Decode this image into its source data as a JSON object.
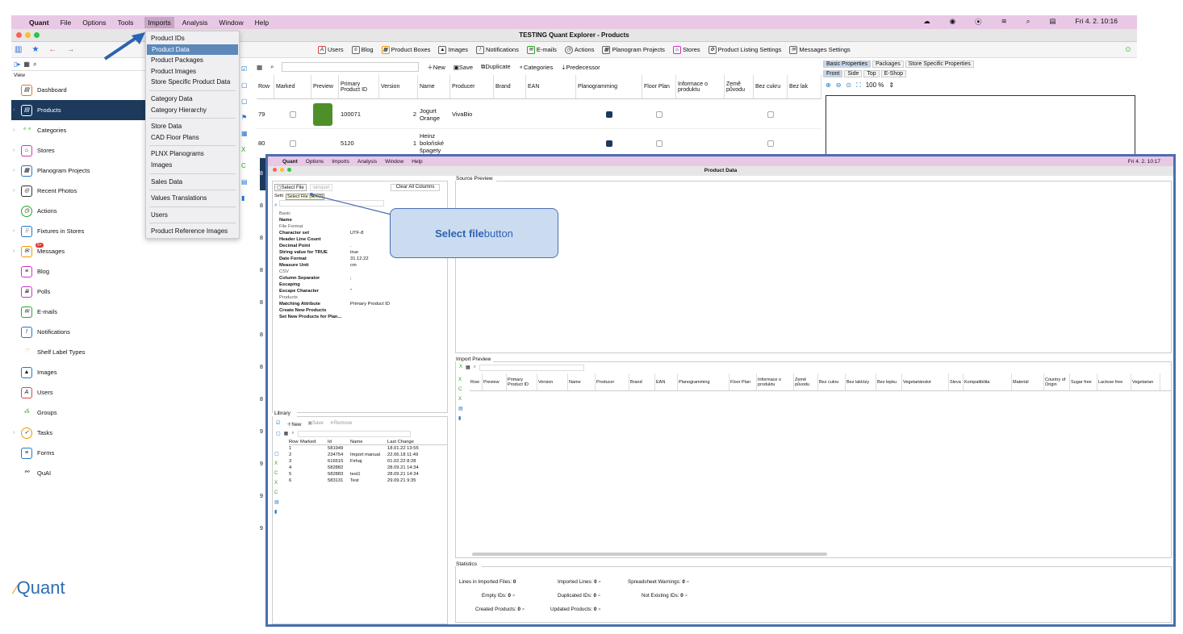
{
  "menubar": {
    "app": "Quant",
    "items": [
      "File",
      "Options",
      "Tools",
      "Imports",
      "Analysis",
      "Window",
      "Help"
    ],
    "clock": "Fri 4. 2.  10:16"
  },
  "window": {
    "title": "TESTING Quant Explorer - Products"
  },
  "toolbar": {
    "items": [
      "Users",
      "Blog",
      "Product Boxes",
      "Images",
      "Notifications",
      "E-mails",
      "Actions",
      "Planogram Projects",
      "Stores",
      "Product Listing Settings",
      "Messages Settings"
    ]
  },
  "sidebar": {
    "view_label": "View",
    "items": [
      "Dashboard",
      "Products",
      "Categories",
      "Stores",
      "Planogram Projects",
      "Recent Photos",
      "Actions",
      "Fixtures in Stores",
      "Messages",
      "Blog",
      "Polls",
      "E-mails",
      "Notifications",
      "Shelf Label Types",
      "Images",
      "Users",
      "Groups",
      "Tasks",
      "Forms",
      "QuAI"
    ],
    "messages_badge": "9+"
  },
  "logo": "Quant",
  "imports_menu": {
    "items": [
      "Product IDs",
      "Product Data",
      "Product Packages",
      "Product Images",
      "Store Specific Product Data",
      "Category Data",
      "Category Hierarchy",
      "Store Data",
      "CAD Floor Plans",
      "PLNX Planograms",
      "Images",
      "Sales Data",
      "Values Translations",
      "Users",
      "Product Reference Images"
    ]
  },
  "products": {
    "toolbar": [
      "New",
      "Save",
      "Duplicate",
      "Categories",
      "Predecessor"
    ],
    "columns": [
      "Row",
      "Marked",
      "Preview",
      "Primary Product ID",
      "Version",
      "Name",
      "Producer",
      "Brand",
      "EAN",
      "Planogramming",
      "Floor Plan",
      "Informace o produktu",
      "Země původu",
      "Bez cukru",
      "Bez lak"
    ],
    "rows": [
      {
        "row": "79",
        "id": "100071",
        "version": "2",
        "name": "Jogurt Orange",
        "producer": "VivaBio"
      },
      {
        "row": "80",
        "id": "5120",
        "version": "1",
        "name": "Heinz boloňské špagety",
        "producer": ""
      }
    ],
    "more_rows": [
      "8",
      "8",
      "8",
      "8",
      "8",
      "8",
      "8",
      "8",
      "9",
      "9",
      "9",
      "9"
    ]
  },
  "right_panel": {
    "tabs": [
      "Basic Properties",
      "Packages",
      "Store Specific Properties"
    ],
    "views": [
      "Front",
      "Side",
      "Top",
      "E-Shop"
    ],
    "zoom": "100 %"
  },
  "overlay": {
    "menubar": {
      "app": "Quant",
      "items": [
        "Options",
        "Imports",
        "Analysis",
        "Window",
        "Help"
      ],
      "clock": "Fri 4. 2.  10:17"
    },
    "title": "Product Data",
    "select_file": "Select File",
    "import": "Import",
    "clear_all": "Clear All Columns",
    "tooltip": "Select File (⌘KO)",
    "settings_label": "Setti",
    "settings": [
      {
        "k": "Basic",
        "v": "",
        "h": true
      },
      {
        "k": "Name",
        "v": ""
      },
      {
        "k": "File Format",
        "v": "",
        "h": true
      },
      {
        "k": "Character set",
        "v": "UTF-8"
      },
      {
        "k": "Header Line Count",
        "v": ""
      },
      {
        "k": "Decimal Point",
        "v": "."
      },
      {
        "k": "String value for TRUE",
        "v": "true"
      },
      {
        "k": "Date Format",
        "v": "31.12.22"
      },
      {
        "k": "Measure Unit",
        "v": "cm"
      },
      {
        "k": "CSV",
        "v": "",
        "h": true
      },
      {
        "k": "Column Separator",
        "v": ";"
      },
      {
        "k": "Escaping",
        "v": ""
      },
      {
        "k": "Escape Character",
        "v": "\""
      },
      {
        "k": "Products",
        "v": "",
        "h": true
      },
      {
        "k": "Matching Attribute",
        "v": "Primary Product ID"
      },
      {
        "k": "Create New Products",
        "v": ""
      },
      {
        "k": "Set New Products for Plan...",
        "v": ""
      }
    ],
    "library": {
      "title": "Library",
      "toolbar": [
        "New",
        "Save",
        "Remove"
      ],
      "columns": [
        "Row",
        "Marked",
        "Id",
        "Name",
        "Last Change"
      ],
      "rows": [
        [
          "1",
          "",
          "581949",
          "",
          "18.01.22 13:55"
        ],
        [
          "2",
          "",
          "234754",
          "Import manual",
          "22.06.18 11:49"
        ],
        [
          "3",
          "",
          "616515",
          "Firhaj",
          "01.02.22 8:28"
        ],
        [
          "4",
          "",
          "582882",
          "",
          "28.09.21 14:34"
        ],
        [
          "5",
          "",
          "582883",
          "test1",
          "28.09.21 14:34"
        ],
        [
          "6",
          "",
          "583131",
          "Test",
          "29.09.21 9:35"
        ]
      ]
    },
    "source_preview": "Source Preview",
    "import_preview": "Import Preview",
    "import_columns": [
      "Row",
      "Preview",
      "Primary Product ID",
      "Version",
      "Name",
      "Producer",
      "Brand",
      "EAN",
      "Planogramming",
      "Floor Plan",
      "Informace o produktu",
      "Země původu",
      "Bez cukru",
      "Bez laktózy",
      "Bez lepku",
      "Vegetariánské",
      "Sleva",
      "Kompatibilita",
      "Materiál",
      "Country of Origin",
      "Sugar free",
      "Lactose free",
      "Vegetarian"
    ],
    "statistics": {
      "title": "Statistics",
      "items": [
        {
          "label": "Lines in Imported Files:",
          "value": "0"
        },
        {
          "label": "Imported Lines:",
          "value": "0"
        },
        {
          "label": "Spreadsheet Warnings:",
          "value": "0"
        },
        {
          "label": "Empty IDs:",
          "value": "0"
        },
        {
          "label": "Duplicated IDs:",
          "value": "0"
        },
        {
          "label": "Not Existing IDs:",
          "value": "0"
        },
        {
          "label": "Created Products:",
          "value": "0"
        },
        {
          "label": "Updated Products:",
          "value": "0"
        }
      ]
    }
  },
  "callout": {
    "bold": "Select file",
    "rest": " button"
  }
}
